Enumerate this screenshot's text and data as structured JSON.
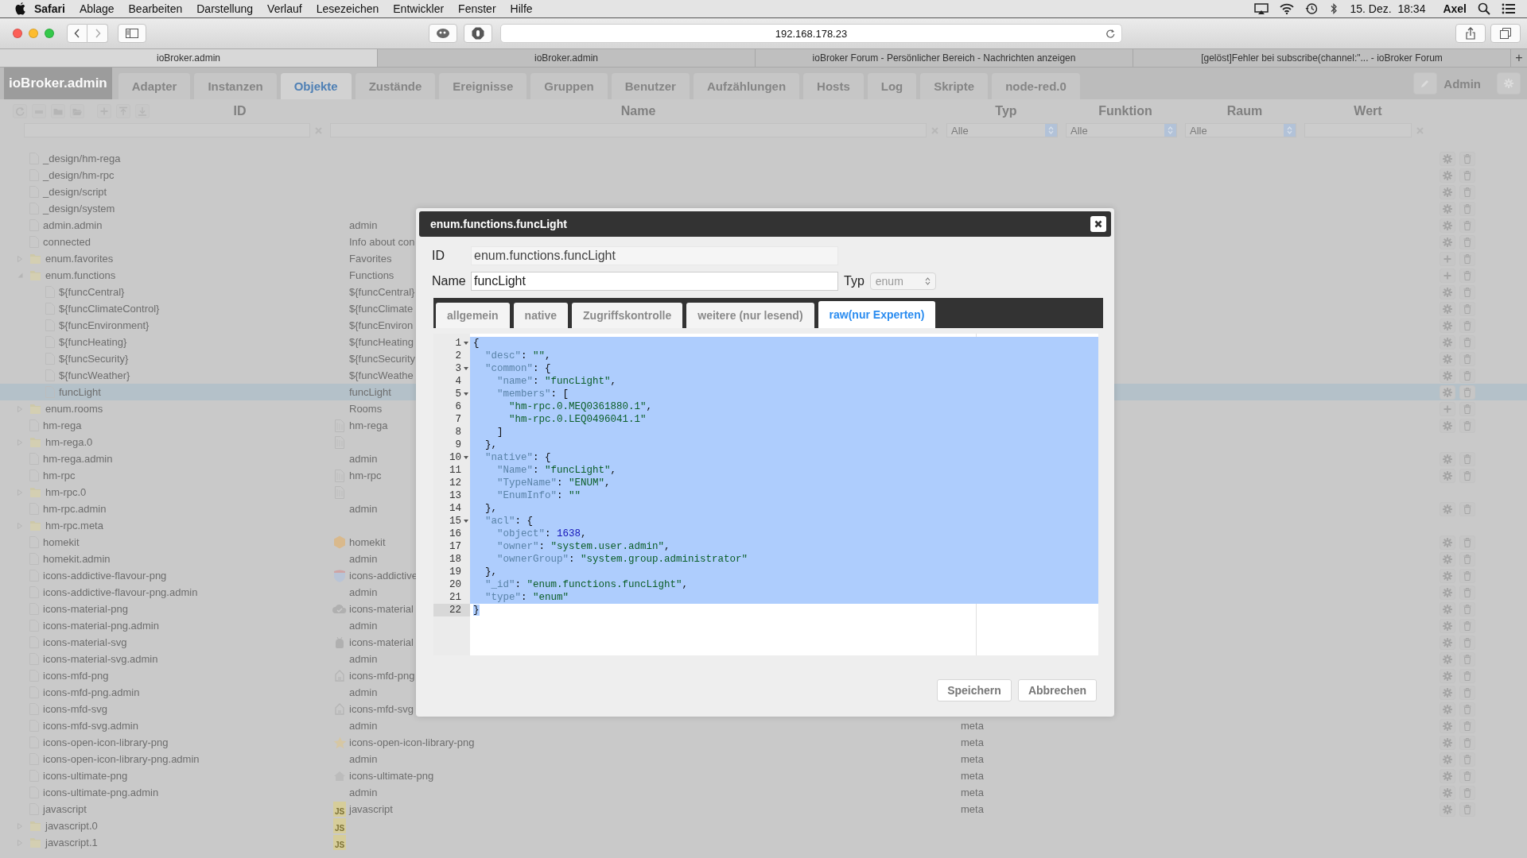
{
  "menu_bar": {
    "app": "Safari",
    "menus": [
      "Ablage",
      "Bearbeiten",
      "Darstellung",
      "Verlauf",
      "Lesezeichen",
      "Entwickler",
      "Fenster",
      "Hilfe"
    ],
    "clock": "15. Dez.  18:34",
    "user": "Axel"
  },
  "browser": {
    "address": "192.168.178.23",
    "new_tab": "+",
    "tabs": [
      {
        "title": "ioBroker.admin",
        "selected": true
      },
      {
        "title": "ioBroker.admin",
        "selected": false
      },
      {
        "title": "ioBroker Forum - Persönlicher Bereich - Nachrichten anzeigen",
        "selected": false
      },
      {
        "title": "[gelöst]Fehler bei subscribe(channel:\"... - ioBroker Forum",
        "selected": false
      }
    ]
  },
  "app": {
    "logo": "ioBroker.admin",
    "user": "Admin",
    "nav_tabs": [
      {
        "label": "Adapter",
        "selected": false
      },
      {
        "label": "Instanzen",
        "selected": false
      },
      {
        "label": "Objekte",
        "selected": true
      },
      {
        "label": "Zustände",
        "selected": false
      },
      {
        "label": "Ereignisse",
        "selected": false
      },
      {
        "label": "Gruppen",
        "selected": false
      },
      {
        "label": "Benutzer",
        "selected": false
      },
      {
        "label": "Aufzählungen",
        "selected": false
      },
      {
        "label": "Hosts",
        "selected": false
      },
      {
        "label": "Log",
        "selected": false
      },
      {
        "label": "Skripte",
        "selected": false
      },
      {
        "label": "node-red.0",
        "selected": false
      }
    ]
  },
  "table": {
    "columns": [
      "ID",
      "Name",
      "Typ",
      "Funktion",
      "Raum",
      "Wert"
    ],
    "filters": [
      {
        "kind": "search"
      },
      {
        "kind": "search"
      },
      {
        "kind": "select",
        "value": "Alle"
      },
      {
        "kind": "select",
        "value": "Alle"
      },
      {
        "kind": "select",
        "value": "Alle"
      },
      {
        "kind": "search"
      }
    ],
    "rows": [
      {
        "id": "_design/hm-rega",
        "kind": "object",
        "edit_button": true,
        "delete_button": true,
        "selected": false
      },
      {
        "id": "_design/hm-rpc",
        "kind": "object",
        "edit_button": true,
        "delete_button": true,
        "selected": false
      },
      {
        "id": "_design/script",
        "kind": "object",
        "edit_button": true,
        "delete_button": true,
        "selected": false
      },
      {
        "id": "_design/system",
        "kind": "object",
        "edit_button": true,
        "delete_button": true,
        "selected": false
      },
      {
        "id": "admin.admin",
        "kind": "object",
        "name": "admin",
        "edit_button": true,
        "delete_button": true,
        "selected": false
      },
      {
        "id": "connected",
        "kind": "object",
        "name": "Info about con",
        "edit_button": true,
        "delete_button": true,
        "selected": false
      },
      {
        "id": "enum.favorites",
        "kind": "folder",
        "expanded": false,
        "name": "Favorites",
        "add_button": true,
        "delete_button": true,
        "selected": false
      },
      {
        "id": "enum.functions",
        "kind": "folder",
        "expanded": true,
        "name": "Functions",
        "add_button": true,
        "delete_button": true,
        "selected": false,
        "children": [
          {
            "id": "${funcCentral}",
            "kind": "object",
            "name": "${funcCentral}",
            "edit_button": true,
            "delete_button": true,
            "selected": false
          },
          {
            "id": "${funcClimateControl}",
            "kind": "object",
            "name": "${funcClimate",
            "edit_button": true,
            "delete_button": true,
            "selected": false
          },
          {
            "id": "${funcEnvironment}",
            "kind": "object",
            "name": "${funcEnviron",
            "edit_button": true,
            "delete_button": true,
            "selected": false
          },
          {
            "id": "${funcHeating}",
            "kind": "object",
            "name": "${funcHeating",
            "edit_button": true,
            "delete_button": true,
            "selected": false
          },
          {
            "id": "${funcSecurity}",
            "kind": "object",
            "name": "${funcSecurity",
            "edit_button": true,
            "delete_button": true,
            "selected": false
          },
          {
            "id": "${funcWeather}",
            "kind": "object",
            "name": "${funcWeathe",
            "edit_button": true,
            "delete_button": true,
            "selected": false
          },
          {
            "id": "funcLight",
            "kind": "object",
            "name": "funcLight",
            "edit_button": true,
            "delete_button": true,
            "selected": true
          }
        ]
      },
      {
        "id": "enum.rooms",
        "kind": "folder",
        "expanded": false,
        "name": "Rooms",
        "add_button": true,
        "delete_button": true,
        "selected": false
      },
      {
        "id": "hm-rega",
        "kind": "object",
        "name_icon": {
          "kind": "page"
        },
        "name": "hm-rega",
        "edit_button": true,
        "delete_button": true,
        "selected": false
      },
      {
        "id": "hm-rega.0",
        "kind": "folder",
        "expanded": false,
        "name_icon": {
          "kind": "page"
        },
        "selected": false
      },
      {
        "id": "hm-rega.admin",
        "kind": "object",
        "name": "admin",
        "edit_button": true,
        "delete_button": true,
        "selected": false
      },
      {
        "id": "hm-rpc",
        "kind": "object",
        "name_icon": {
          "kind": "page"
        },
        "name": "hm-rpc",
        "edit_button": true,
        "delete_button": true,
        "selected": false
      },
      {
        "id": "hm-rpc.0",
        "kind": "folder",
        "expanded": false,
        "name_icon": {
          "kind": "page"
        },
        "selected": false
      },
      {
        "id": "hm-rpc.admin",
        "kind": "object",
        "name": "admin",
        "edit_button": true,
        "delete_button": true,
        "selected": false
      },
      {
        "id": "hm-rpc.meta",
        "kind": "folder",
        "expanded": false,
        "selected": false
      },
      {
        "id": "homekit",
        "kind": "object",
        "name_icon": {
          "kind": "hexagon"
        },
        "name": "homekit",
        "edit_button": true,
        "delete_button": true,
        "selected": false
      },
      {
        "id": "homekit.admin",
        "kind": "object",
        "name": "admin",
        "edit_button": true,
        "delete_button": true,
        "selected": false
      },
      {
        "id": "icons-addictive-flavour-png",
        "kind": "object",
        "name_icon": {
          "kind": "shield"
        },
        "name": "icons-addictive",
        "edit_button": true,
        "delete_button": true,
        "selected": false
      },
      {
        "id": "icons-addictive-flavour-png.admin",
        "kind": "object",
        "name": "admin",
        "edit_button": true,
        "delete_button": true,
        "selected": false
      },
      {
        "id": "icons-material-png",
        "kind": "object",
        "name_icon": {
          "kind": "cloud"
        },
        "name": "icons-material",
        "edit_button": true,
        "delete_button": true,
        "selected": false
      },
      {
        "id": "icons-material-png.admin",
        "kind": "object",
        "name": "admin",
        "edit_button": true,
        "delete_button": true,
        "selected": false
      },
      {
        "id": "icons-material-svg",
        "kind": "object",
        "name_icon": {
          "kind": "robot"
        },
        "name": "icons-material",
        "edit_button": true,
        "delete_button": true,
        "selected": false
      },
      {
        "id": "icons-material-svg.admin",
        "kind": "object",
        "name": "admin",
        "edit_button": true,
        "delete_button": true,
        "selected": false
      },
      {
        "id": "icons-mfd-png",
        "kind": "object",
        "name_icon": {
          "kind": "house"
        },
        "name": "icons-mfd-png",
        "edit_button": true,
        "delete_button": true,
        "selected": false
      },
      {
        "id": "icons-mfd-png.admin",
        "kind": "object",
        "name": "admin",
        "edit_button": true,
        "delete_button": true,
        "selected": false
      },
      {
        "id": "icons-mfd-svg",
        "kind": "object",
        "name_icon": {
          "kind": "house"
        },
        "name": "icons-mfd-svg",
        "edit_button": true,
        "delete_button": true,
        "selected": false
      },
      {
        "id": "icons-mfd-svg.admin",
        "kind": "object",
        "name": "admin",
        "type": "meta",
        "edit_button": true,
        "delete_button": true,
        "selected": false
      },
      {
        "id": "icons-open-icon-library-png",
        "kind": "object",
        "name_icon": {
          "kind": "star"
        },
        "name": "icons-open-icon-library-png",
        "type": "meta",
        "edit_button": true,
        "delete_button": true,
        "selected": false
      },
      {
        "id": "icons-open-icon-library-png.admin",
        "kind": "object",
        "name": "admin",
        "type": "meta",
        "edit_button": true,
        "delete_button": true,
        "selected": false
      },
      {
        "id": "icons-ultimate-png",
        "kind": "object",
        "name_icon": {
          "kind": "home"
        },
        "name": "icons-ultimate-png",
        "type": "meta",
        "edit_button": true,
        "delete_button": true,
        "selected": false
      },
      {
        "id": "icons-ultimate-png.admin",
        "kind": "object",
        "name": "admin",
        "type": "meta",
        "edit_button": true,
        "delete_button": true,
        "selected": false
      },
      {
        "id": "javascript",
        "kind": "object",
        "name_icon": {
          "kind": "js",
          "text": "JS"
        },
        "name": "javascript",
        "type": "meta",
        "edit_button": true,
        "delete_button": true,
        "selected": false
      },
      {
        "id": "javascript.0",
        "kind": "folder",
        "expanded": false,
        "name_icon": {
          "kind": "js",
          "text": "JS"
        },
        "selected": false
      },
      {
        "id": "javascript.1",
        "kind": "folder",
        "expanded": false,
        "name_icon": {
          "kind": "js",
          "text": "JS"
        },
        "selected": false
      }
    ]
  },
  "dialog": {
    "title": "enum.functions.funcLight",
    "id_label": "ID",
    "id_value": "enum.functions.funcLight",
    "name_label": "Name",
    "name_value": "funcLight",
    "type_label": "Typ",
    "type_value": "enum",
    "tabs": [
      {
        "label": "allgemein",
        "selected": false
      },
      {
        "label": "native",
        "selected": false
      },
      {
        "label": "Zugriffskontrolle",
        "selected": false
      },
      {
        "label": "weitere (nur lesend)",
        "selected": false
      },
      {
        "label": "raw(nur Experten)",
        "selected": true
      }
    ],
    "editor": {
      "lines": [
        {
          "number": "1",
          "text": "{",
          "foldable": true,
          "selected": true,
          "active": false
        },
        {
          "number": "2",
          "text": "  \"desc\": \"\",",
          "foldable": false,
          "selected": true,
          "active": false
        },
        {
          "number": "3",
          "text": "  \"common\": {",
          "foldable": true,
          "selected": true,
          "active": false
        },
        {
          "number": "4",
          "text": "    \"name\": \"funcLight\",",
          "foldable": false,
          "selected": true,
          "active": false
        },
        {
          "number": "5",
          "text": "    \"members\": [",
          "foldable": true,
          "selected": true,
          "active": false
        },
        {
          "number": "6",
          "text": "      \"hm-rpc.0.MEQ0361880.1\",",
          "foldable": false,
          "selected": true,
          "active": false
        },
        {
          "number": "7",
          "text": "      \"hm-rpc.0.LEQ0496041.1\"",
          "foldable": false,
          "selected": true,
          "active": false
        },
        {
          "number": "8",
          "text": "    ]",
          "foldable": false,
          "selected": true,
          "active": false
        },
        {
          "number": "9",
          "text": "  },",
          "foldable": false,
          "selected": true,
          "active": false
        },
        {
          "number": "10",
          "text": "  \"native\": {",
          "foldable": true,
          "selected": true,
          "active": false
        },
        {
          "number": "11",
          "text": "    \"Name\": \"funcLight\",",
          "foldable": false,
          "selected": true,
          "active": false
        },
        {
          "number": "12",
          "text": "    \"TypeName\": \"ENUM\",",
          "foldable": false,
          "selected": true,
          "active": false
        },
        {
          "number": "13",
          "text": "    \"EnumInfo\": \"\"",
          "foldable": false,
          "selected": true,
          "active": false
        },
        {
          "number": "14",
          "text": "  },",
          "foldable": false,
          "selected": true,
          "active": false
        },
        {
          "number": "15",
          "text": "  \"acl\": {",
          "foldable": true,
          "selected": true,
          "active": false
        },
        {
          "number": "16",
          "text": "    \"object\": 1638,",
          "foldable": false,
          "selected": true,
          "active": false
        },
        {
          "number": "17",
          "text": "    \"owner\": \"system.user.admin\",",
          "foldable": false,
          "selected": true,
          "active": false
        },
        {
          "number": "18",
          "text": "    \"ownerGroup\": \"system.group.administrator\"",
          "foldable": false,
          "selected": true,
          "active": false
        },
        {
          "number": "19",
          "text": "  },",
          "foldable": false,
          "selected": true,
          "active": false
        },
        {
          "number": "20",
          "text": "  \"_id\": \"enum.functions.funcLight\",",
          "foldable": false,
          "selected": true,
          "active": false
        },
        {
          "number": "21",
          "text": "  \"type\": \"enum\"",
          "foldable": false,
          "selected": true,
          "active": false
        },
        {
          "number": "22",
          "text": "}",
          "foldable": false,
          "selected": true,
          "active": true
        }
      ]
    },
    "buttons": [
      "Speichern",
      "Abbrechen"
    ]
  }
}
